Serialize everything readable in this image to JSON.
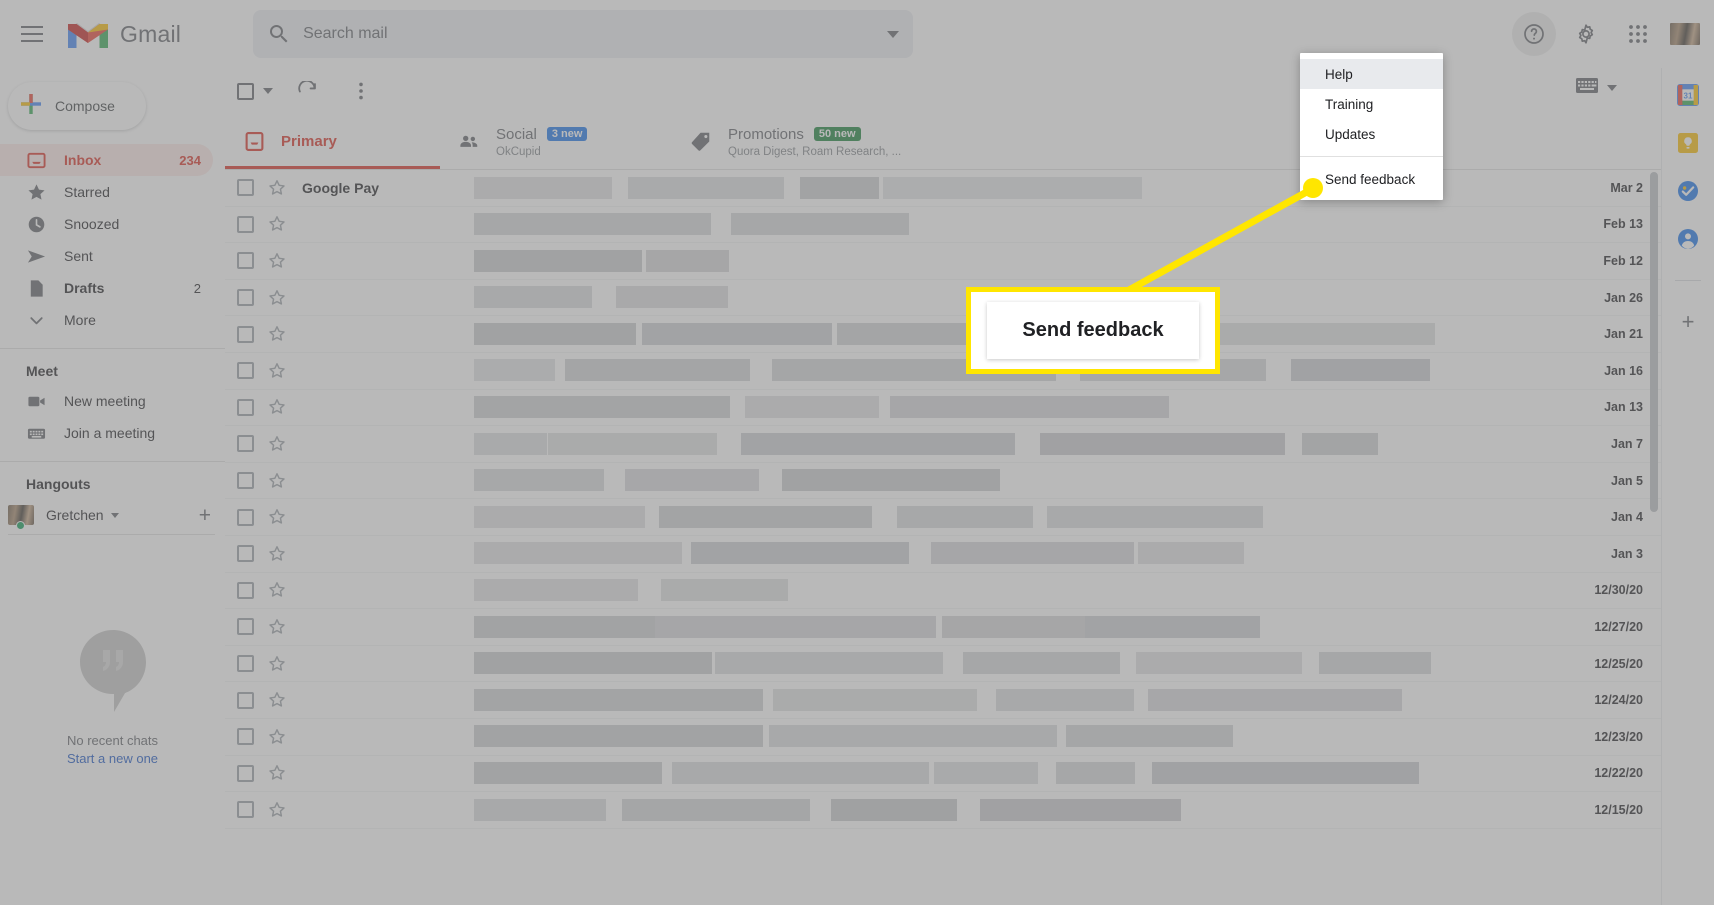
{
  "app": {
    "brand": "Gmail"
  },
  "topbar": {
    "menu_icon": "hamburger-menu-icon",
    "search": {
      "placeholder": "Search mail",
      "value": ""
    },
    "help_icon": "help-circle-icon",
    "settings_icon": "gear-icon",
    "apps_icon": "apps-grid-icon",
    "avatar_icon": "account-avatar"
  },
  "sidebar": {
    "compose_label": "Compose",
    "items": [
      {
        "label": "Inbox",
        "count": "234",
        "icon": "inbox-icon",
        "selected": true
      },
      {
        "label": "Starred",
        "count": "",
        "icon": "star-icon",
        "selected": false
      },
      {
        "label": "Snoozed",
        "count": "",
        "icon": "clock-icon",
        "selected": false
      },
      {
        "label": "Sent",
        "count": "",
        "icon": "send-icon",
        "selected": false
      },
      {
        "label": "Drafts",
        "count": "2",
        "icon": "document-icon",
        "selected": false
      },
      {
        "label": "More",
        "count": "",
        "icon": "chevron-down-icon",
        "selected": false
      }
    ],
    "meet": {
      "title": "Meet",
      "items": [
        {
          "label": "New meeting",
          "icon": "video-camera-icon"
        },
        {
          "label": "Join a meeting",
          "icon": "keyboard-icon"
        }
      ]
    },
    "hangouts": {
      "title": "Hangouts",
      "user": "Gretchen",
      "add_icon": "plus-icon",
      "empty_message": "No recent chats",
      "empty_link": "Start a new one",
      "empty_icon": "hangouts-icon"
    }
  },
  "list_toolbar": {
    "select_all_icon": "checkbox-icon",
    "select_dropdown_icon": "chevron-down-icon",
    "refresh_icon": "refresh-icon",
    "more_icon": "more-vertical-icon",
    "input_tools_icon": "keyboard-icon",
    "input_tools_caret": "chevron-down-icon"
  },
  "tabs": [
    {
      "title": "Primary",
      "badge": "",
      "badge_color": "",
      "sub": "",
      "icon": "inbox-tab-icon",
      "active": true
    },
    {
      "title": "Social",
      "badge": "3 new",
      "badge_color": "#1a73e8",
      "sub": "OkCupid",
      "icon": "people-icon",
      "active": false
    },
    {
      "title": "Promotions",
      "badge": "50 new",
      "badge_color": "#188038",
      "sub": "Quora Digest, Roam Research, ...",
      "icon": "tag-icon",
      "active": false
    }
  ],
  "emails": [
    {
      "sender": "Google Pay",
      "date": "Mar 2"
    },
    {
      "sender": "",
      "date": "Feb 13"
    },
    {
      "sender": "",
      "date": "Feb 12"
    },
    {
      "sender": "",
      "date": "Jan 26"
    },
    {
      "sender": "",
      "date": "Jan 21"
    },
    {
      "sender": "",
      "date": "Jan 16"
    },
    {
      "sender": "",
      "date": "Jan 13"
    },
    {
      "sender": "",
      "date": "Jan 7"
    },
    {
      "sender": "",
      "date": "Jan 5"
    },
    {
      "sender": "",
      "date": "Jan 4"
    },
    {
      "sender": "",
      "date": "Jan 3"
    },
    {
      "sender": "",
      "date": "12/30/20"
    },
    {
      "sender": "",
      "date": "12/27/20"
    },
    {
      "sender": "",
      "date": "12/25/20"
    },
    {
      "sender": "",
      "date": "12/24/20"
    },
    {
      "sender": "",
      "date": "12/23/20"
    },
    {
      "sender": "",
      "date": "12/22/20"
    },
    {
      "sender": "",
      "date": "12/15/20"
    }
  ],
  "help_menu": {
    "items": [
      {
        "label": "Help",
        "highlighted": true
      },
      {
        "label": "Training",
        "highlighted": false
      },
      {
        "label": "Updates",
        "highlighted": false
      }
    ],
    "feedback_label": "Send feedback"
  },
  "callout": {
    "text": "Send feedback",
    "highlight_color": "#ffe600"
  },
  "rail": {
    "items": [
      {
        "icon": "google-calendar-icon"
      },
      {
        "icon": "google-keep-icon"
      },
      {
        "icon": "google-tasks-icon"
      },
      {
        "icon": "google-contacts-icon"
      }
    ],
    "add_label": "+"
  }
}
